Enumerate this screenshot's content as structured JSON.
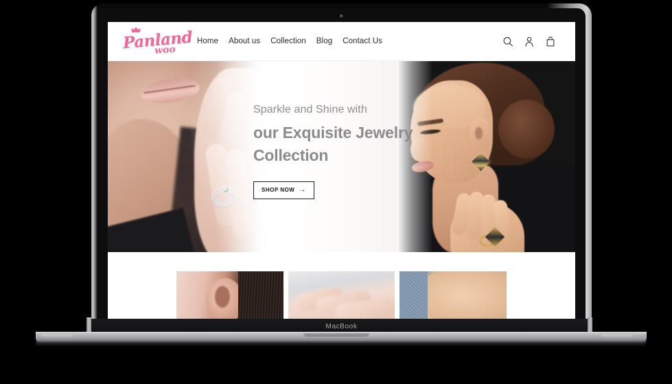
{
  "device": {
    "name": "MacBook",
    "chin_label": "MacBook",
    "camera": "camera-dot"
  },
  "site": {
    "logo": {
      "primary": "Panland",
      "secondary": "woo",
      "ornament": "crown-icon",
      "color": "#ef6a95"
    },
    "nav": [
      {
        "label": "Home"
      },
      {
        "label": "About us"
      },
      {
        "label": "Collection"
      },
      {
        "label": "Blog"
      },
      {
        "label": "Contact Us"
      }
    ],
    "header_icons": [
      {
        "name": "search-icon"
      },
      {
        "name": "account-icon"
      },
      {
        "name": "shopping-bag-icon"
      }
    ]
  },
  "hero": {
    "kicker": "Sparkle and Shine with",
    "title_line1": "our Exquisite Jewelry",
    "title_line2": "Collection",
    "cta_label": "SHOP NOW",
    "cta_arrow": "→",
    "kicker_color": "#8d8d8f",
    "title_color": "#8b8b8d",
    "left_image_alt": "close-up of woman's lips and hand wearing a silver ring",
    "right_image_alt": "model with slicked-back hair wearing gold earring and ring"
  },
  "categories": [
    {
      "name": "category-earrings",
      "alt": "close-up of ear with dark hair"
    },
    {
      "name": "category-rings",
      "alt": "close-up of hand and fingers"
    },
    {
      "name": "category-necklaces",
      "alt": "close-up of neck and shoulder with denim"
    }
  ]
}
